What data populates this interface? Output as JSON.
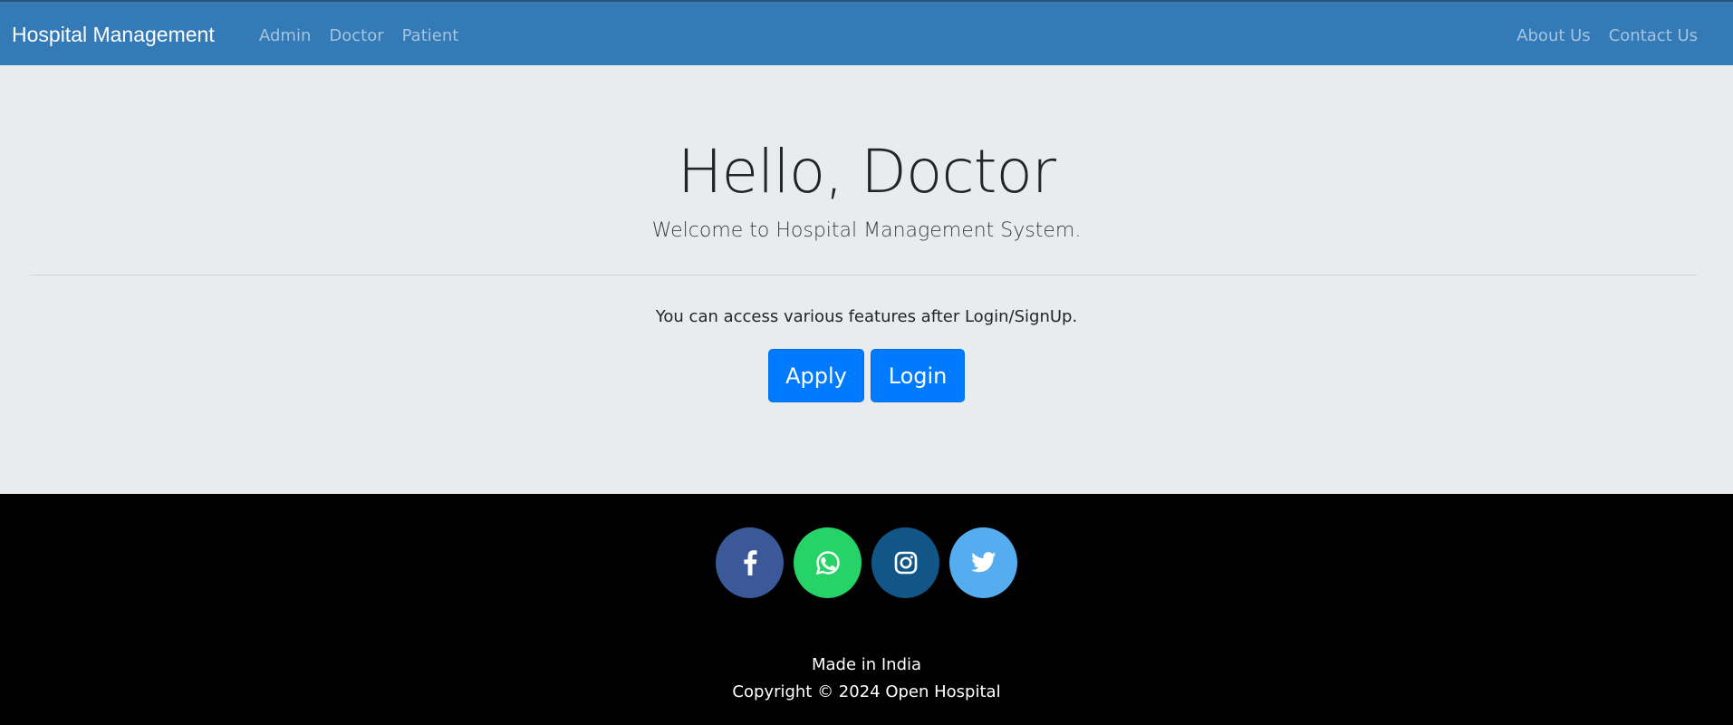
{
  "navbar": {
    "brand": "Hospital Management",
    "left_links": [
      {
        "label": "Admin"
      },
      {
        "label": "Doctor"
      },
      {
        "label": "Patient"
      }
    ],
    "right_links": [
      {
        "label": "About Us"
      },
      {
        "label": "Contact Us"
      }
    ],
    "background": "#337ab7"
  },
  "hero": {
    "title": "Hello, Doctor",
    "subtitle": "Welcome to Hospital Management System.",
    "info": "You can access various features after Login/SignUp.",
    "buttons": {
      "apply_label": "Apply",
      "login_label": "Login"
    },
    "background": "#e9ecef",
    "button_color": "#007bff"
  },
  "footer": {
    "social": [
      {
        "name": "facebook-icon",
        "color": "#3b5998"
      },
      {
        "name": "whatsapp-icon",
        "color": "#25d366"
      },
      {
        "name": "instagram-icon",
        "color": "#125688"
      },
      {
        "name": "twitter-icon",
        "color": "#55acee"
      }
    ],
    "made_in": "Made in India",
    "copyright": "Copyright © 2024 Open Hospital",
    "background": "#000000"
  }
}
